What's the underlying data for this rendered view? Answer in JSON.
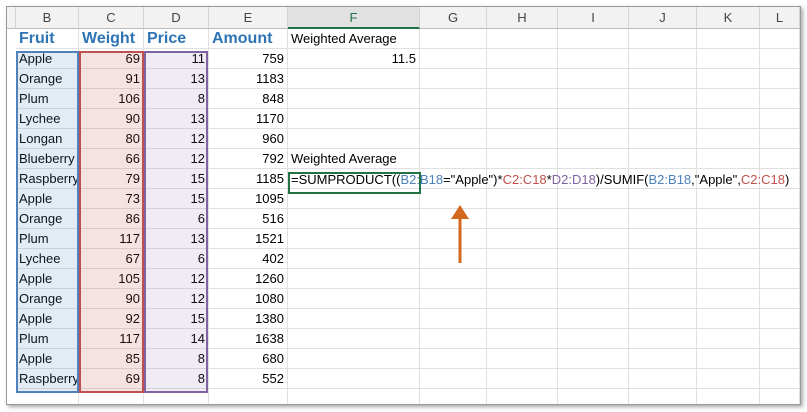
{
  "columns": [
    "B",
    "C",
    "D",
    "E",
    "F",
    "G",
    "H",
    "I",
    "J",
    "K",
    "L"
  ],
  "selected_column": "F",
  "headers": {
    "fruit": "Fruit",
    "weight": "Weight",
    "price": "Price",
    "amount": "Amount"
  },
  "rows": [
    {
      "fruit": "Apple",
      "weight": "69",
      "price": "11",
      "amount": "759"
    },
    {
      "fruit": "Orange",
      "weight": "91",
      "price": "13",
      "amount": "1183"
    },
    {
      "fruit": "Plum",
      "weight": "106",
      "price": "8",
      "amount": "848"
    },
    {
      "fruit": "Lychee",
      "weight": "90",
      "price": "13",
      "amount": "1170"
    },
    {
      "fruit": "Longan",
      "weight": "80",
      "price": "12",
      "amount": "960"
    },
    {
      "fruit": "Blueberry",
      "weight": "66",
      "price": "12",
      "amount": "792"
    },
    {
      "fruit": "Raspberry",
      "weight": "79",
      "price": "15",
      "amount": "1185"
    },
    {
      "fruit": "Apple",
      "weight": "73",
      "price": "15",
      "amount": "1095"
    },
    {
      "fruit": "Orange",
      "weight": "86",
      "price": "6",
      "amount": "516"
    },
    {
      "fruit": "Plum",
      "weight": "117",
      "price": "13",
      "amount": "1521"
    },
    {
      "fruit": "Lychee",
      "weight": "67",
      "price": "6",
      "amount": "402"
    },
    {
      "fruit": "Apple",
      "weight": "105",
      "price": "12",
      "amount": "1260"
    },
    {
      "fruit": "Orange",
      "weight": "90",
      "price": "12",
      "amount": "1080"
    },
    {
      "fruit": "Apple",
      "weight": "92",
      "price": "15",
      "amount": "1380"
    },
    {
      "fruit": "Plum",
      "weight": "117",
      "price": "14",
      "amount": "1638"
    },
    {
      "fruit": "Apple",
      "weight": "85",
      "price": "8",
      "amount": "680"
    },
    {
      "fruit": "Raspberry",
      "weight": "69",
      "price": "8",
      "amount": "552"
    }
  ],
  "label_top": "Weighted Average",
  "result_value": "11.5",
  "label_second": "Weighted Average",
  "formula": {
    "p1": "=SUMPRODUCT(",
    "p2": "(",
    "p3": "B2:B18",
    "p4": "=\"Apple\"",
    "p5": ")",
    "p6": "*",
    "p7": "C2:C18",
    "p8": "*",
    "p9": "D2:D18",
    "p10": ")/SUMIF(",
    "p11": "B2:B18",
    "p12": ",\"Apple\",",
    "p13": "C2:C18",
    "p14": ")"
  },
  "colors": {
    "ref_b": "#4f81bd",
    "ref_c": "#c0504d",
    "ref_d": "#8064a2",
    "arrow": "#d2691e",
    "header_text": "#2e74b5"
  },
  "icons": [
    "up-arrow-annotation"
  ]
}
